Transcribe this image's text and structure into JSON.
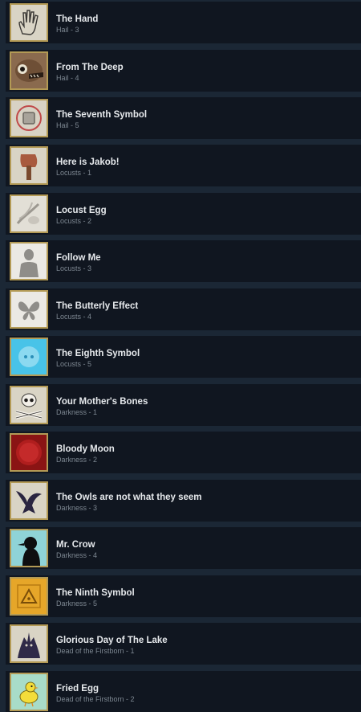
{
  "achievements": [
    {
      "title": "The Hand",
      "sub": "Hail - 3",
      "icon": "hand-icon",
      "color": "#d9d4c5"
    },
    {
      "title": "From The Deep",
      "sub": "Hail - 4",
      "icon": "deep-creature-icon",
      "color": "#8a6a4e"
    },
    {
      "title": "The Seventh Symbol",
      "sub": "Hail - 5",
      "icon": "seventh-symbol-icon",
      "color": "#d8d2c4"
    },
    {
      "title": "Here is Jakob!",
      "sub": "Locusts - 1",
      "icon": "axe-icon",
      "color": "#d9d4c5"
    },
    {
      "title": "Locust Egg",
      "sub": "Locusts - 2",
      "icon": "locust-egg-icon",
      "color": "#e2dfd6"
    },
    {
      "title": "Follow Me",
      "sub": "Locusts - 3",
      "icon": "silhouette-icon",
      "color": "#ebe9e4"
    },
    {
      "title": "The Butterly Effect",
      "sub": "Locusts - 4",
      "icon": "butterfly-icon",
      "color": "#ebe9e4"
    },
    {
      "title": "The Eighth Symbol",
      "sub": "Locusts - 5",
      "icon": "eighth-symbol-icon",
      "color": "#48c3e8"
    },
    {
      "title": "Your Mother's Bones",
      "sub": "Darkness - 1",
      "icon": "skull-bones-icon",
      "color": "#d9d4c5"
    },
    {
      "title": "Bloody Moon",
      "sub": "Darkness - 2",
      "icon": "bloody-moon-icon",
      "color": "#b01e1e"
    },
    {
      "title": "The Owls are not what they seem",
      "sub": "Darkness - 3",
      "icon": "owl-icon",
      "color": "#d9d4c5"
    },
    {
      "title": "Mr. Crow",
      "sub": "Darkness - 4",
      "icon": "crow-icon",
      "color": "#8fd3d7"
    },
    {
      "title": "The Ninth Symbol",
      "sub": "Darkness - 5",
      "icon": "ninth-symbol-icon",
      "color": "#e6a629"
    },
    {
      "title": "Glorious Day of The Lake",
      "sub": "Dead of the Firstborn - 1",
      "icon": "lake-creature-icon",
      "color": "#d9d4c5"
    },
    {
      "title": "Fried Egg",
      "sub": "Dead of the Firstborn - 2",
      "icon": "chick-icon",
      "color": "#a8dcc8"
    }
  ]
}
